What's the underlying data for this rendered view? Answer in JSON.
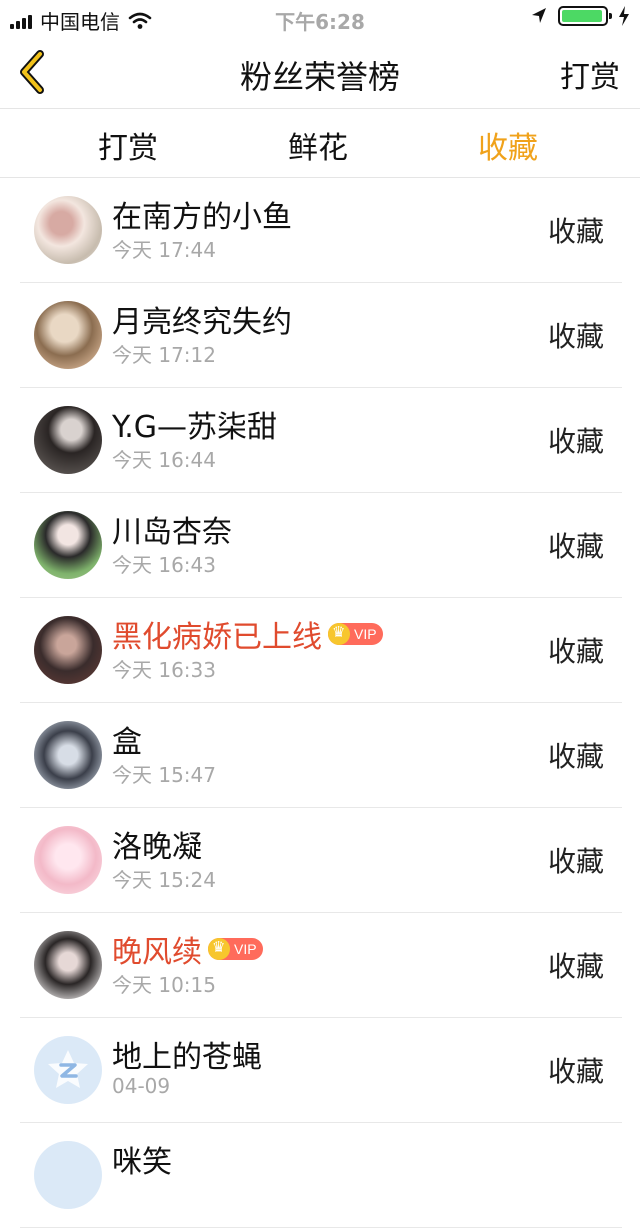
{
  "status": {
    "carrier": "中国电信",
    "time": "下午6:28",
    "battery_level": 0.85
  },
  "nav": {
    "title": "粉丝荣誉榜",
    "action_label": "打赏"
  },
  "tabs": [
    {
      "label": "打赏"
    },
    {
      "label": "鲜花"
    },
    {
      "label": "收藏",
      "active": true
    }
  ],
  "rows": [
    {
      "name": "在南方的小鱼",
      "time": "今天 17:44",
      "action": "收藏",
      "vip": false
    },
    {
      "name": "月亮终究失约",
      "time": "今天 17:12",
      "action": "收藏",
      "vip": false
    },
    {
      "name": "Y.G—苏柒甜",
      "time": "今天 16:44",
      "action": "收藏",
      "vip": false
    },
    {
      "name": "川岛杏奈",
      "time": "今天 16:43",
      "action": "收藏",
      "vip": false
    },
    {
      "name": "黑化病娇已上线",
      "time": "今天 16:33",
      "action": "收藏",
      "vip": true,
      "vip_label": "VIP"
    },
    {
      "name": "盒",
      "time": "今天 15:47",
      "action": "收藏",
      "vip": false
    },
    {
      "name": "洛晚凝",
      "time": "今天 15:24",
      "action": "收藏",
      "vip": false
    },
    {
      "name": "晚风续",
      "time": "今天 10:15",
      "action": "收藏",
      "vip": true,
      "vip_label": "VIP"
    },
    {
      "name": "地上的苍蝇",
      "time": "04-09",
      "action": "收藏",
      "vip": false
    },
    {
      "name": "咪笑",
      "time": "",
      "action": "",
      "vip": false
    }
  ],
  "colors": {
    "accent": "#f0a21b",
    "vip_name": "#e04b2e",
    "muted": "#a8a8a8"
  }
}
